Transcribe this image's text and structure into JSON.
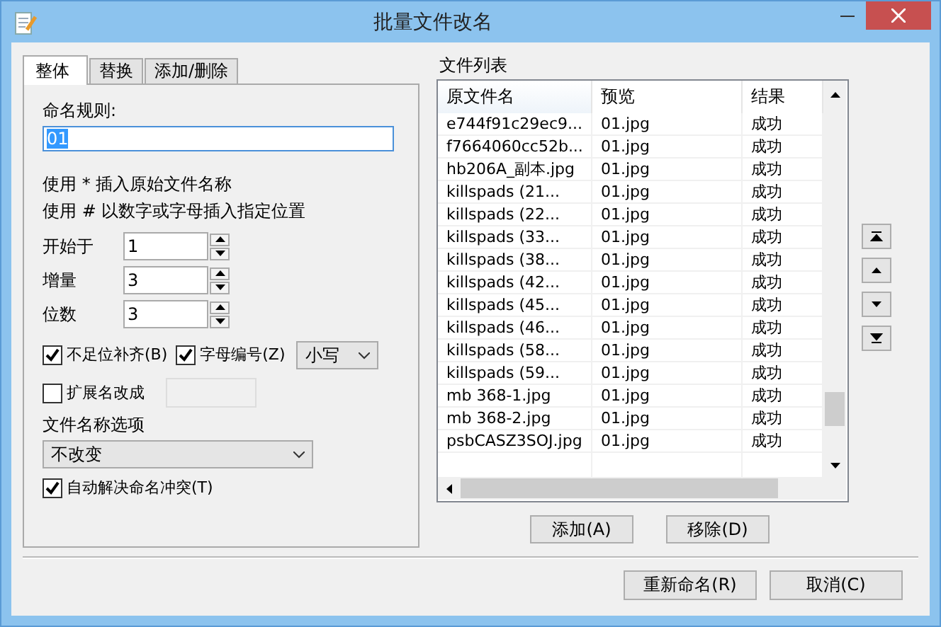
{
  "window": {
    "title": "批量文件改名"
  },
  "tabs": [
    {
      "label": "整体",
      "selected": true
    },
    {
      "label": "替换",
      "selected": false
    },
    {
      "label": "添加/删除",
      "selected": false
    }
  ],
  "naming_rule": {
    "label": "命名规则:",
    "value": "01"
  },
  "hints": [
    "使用 * 插入原始文件名称",
    "使用 # 以数字或字母插入指定位置"
  ],
  "spinners": [
    {
      "label": "开始于",
      "value": "1"
    },
    {
      "label": "增量",
      "value": "3"
    },
    {
      "label": "位数",
      "value": "3"
    }
  ],
  "pad_checkbox": {
    "label": "不足位补齐(B)",
    "checked": true
  },
  "letter_checkbox": {
    "label": "字母编号(Z)",
    "checked": true
  },
  "case_select": {
    "value": "小写"
  },
  "ext_checkbox": {
    "label": "扩展名改成",
    "checked": false
  },
  "filename_options": {
    "label": "文件名称选项",
    "value": "不改变"
  },
  "auto_checkbox": {
    "label": "自动解决命名冲突(T)",
    "checked": true
  },
  "file_list": {
    "title": "文件列表",
    "columns": [
      "原文件名",
      "预览",
      "结果"
    ],
    "rows": [
      [
        "e744f91c29ec9...",
        "01.jpg",
        "成功"
      ],
      [
        "f7664060cc52b...",
        "01.jpg",
        "成功"
      ],
      [
        "hb206A_副本.jpg",
        "01.jpg",
        "成功"
      ],
      [
        "killspads (21...",
        "01.jpg",
        "成功"
      ],
      [
        "killspads (22...",
        "01.jpg",
        "成功"
      ],
      [
        "killspads (33...",
        "01.jpg",
        "成功"
      ],
      [
        "killspads (38...",
        "01.jpg",
        "成功"
      ],
      [
        "killspads (42...",
        "01.jpg",
        "成功"
      ],
      [
        "killspads (45...",
        "01.jpg",
        "成功"
      ],
      [
        "killspads (46...",
        "01.jpg",
        "成功"
      ],
      [
        "killspads (58...",
        "01.jpg",
        "成功"
      ],
      [
        "killspads (59...",
        "01.jpg",
        "成功"
      ],
      [
        "mb 368-1.jpg",
        "01.jpg",
        "成功"
      ],
      [
        "mb 368-2.jpg",
        "01.jpg",
        "成功"
      ],
      [
        "psbCASZ3SOJ.jpg",
        "01.jpg",
        "成功"
      ]
    ]
  },
  "list_buttons": [
    "添加(A)",
    "移除(D)"
  ],
  "footer_buttons": [
    "重新命名(R)",
    "取消(C)"
  ]
}
